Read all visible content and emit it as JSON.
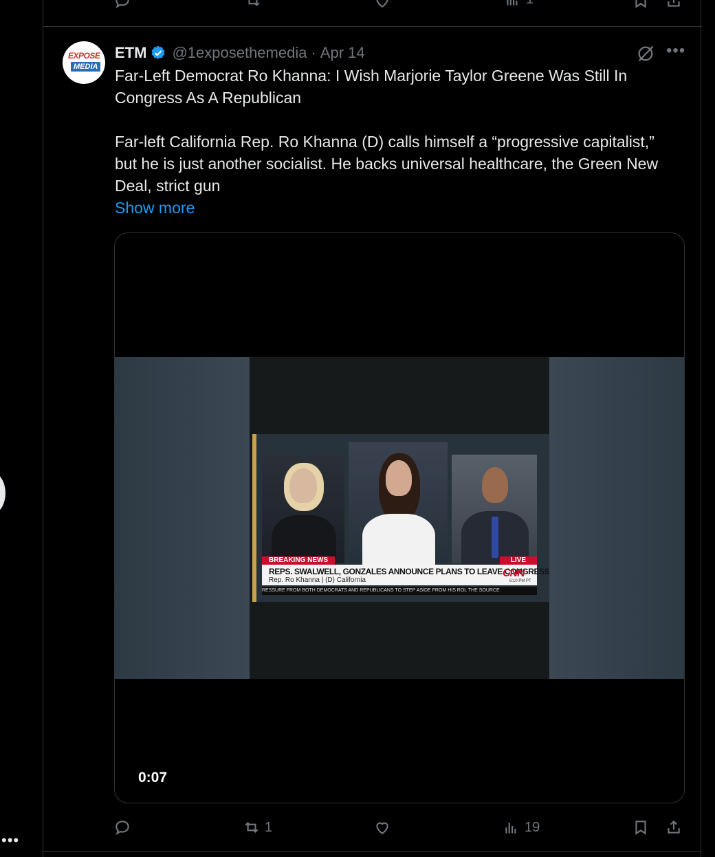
{
  "previous_tweet": {
    "views": "1"
  },
  "tweet": {
    "author_name": "ETM",
    "handle": "@1exposethemedia",
    "separator": "·",
    "date": "Apr 14",
    "avatar_text_top": "EXPOSE",
    "avatar_text_bottom": "MEDIA",
    "headline": "Far-Left Democrat Ro Khanna: I Wish Marjorie Taylor Greene Was Still In Congress As A Republican",
    "body": "Far-left California Rep. Ro Khanna (D) calls himself a “progressive capitalist,” but he is just another socialist. He backs universal healthcare, the Green New Deal, strict gun",
    "show_more": "Show more",
    "video": {
      "duration": "0:07",
      "breaking_tag": "BREAKING NEWS",
      "live_tag": "LIVE",
      "chyron_headline": "REPS. SWALWELL, GONZALES ANNOUNCE PLANS TO LEAVE CONGRESS",
      "chyron_sub": "Rep. Ro Khanna  |  (D) California",
      "network": "CNN",
      "broadcast_time": "6:10 PM PT",
      "ticker": "RESSURE FROM BOTH DEMOCRATS AND REPUBLICANS TO STEP ASIDE FROM HIS ROL THE SOURCE"
    },
    "actions": {
      "reply_count": "",
      "retweet_count": "1",
      "like_count": "",
      "view_count": "19"
    }
  },
  "colors": {
    "background": "#000000",
    "text": "#e7e9ea",
    "secondary": "#71767b",
    "accent": "#1d9bf0",
    "border": "#2f3336"
  },
  "rail": {
    "more_glyph": "•••"
  }
}
